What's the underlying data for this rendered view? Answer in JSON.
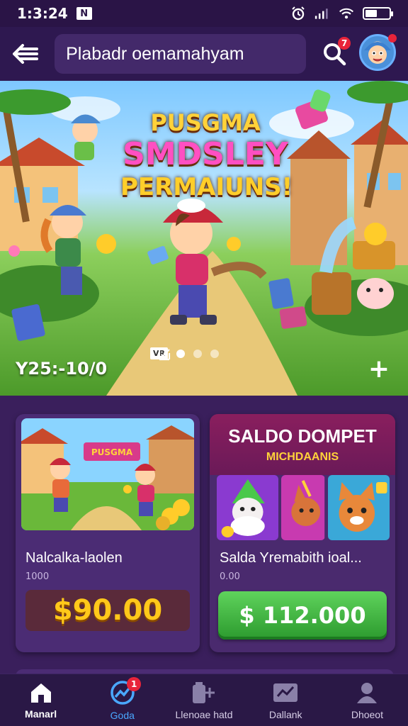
{
  "status_bar": {
    "time": "1:3:24",
    "notification_icon": "n-box-icon",
    "icons": [
      "alarm-icon",
      "signal-icon",
      "wifi-icon",
      "battery-icon"
    ]
  },
  "header": {
    "search_value": "Plabadr oemamahyam",
    "search_badge": "7",
    "icons": {
      "back": "back-arrow-icon",
      "search": "search-icon",
      "avatar": "avatar"
    }
  },
  "banner": {
    "title_line1": "PUSGMA",
    "title_line2": "SMDSLEY",
    "title_line3": "PERMAIUNS!",
    "amount": "Y25:-10/0",
    "tag": "VR",
    "dots": 3,
    "active_dot": 0,
    "plus_label": "+"
  },
  "cards": [
    {
      "name": "Nalcalka-laolen",
      "sub": "1000",
      "price": "$90.00",
      "thumb_caption": "PUSGMA"
    },
    {
      "head_title": "SALDO DOMPET",
      "head_sub": "MICHDAANIS",
      "name": "Salda Yremabith ioal...",
      "sub": "0.00",
      "price": "$ 112.000"
    }
  ],
  "bottom_nav": [
    {
      "label": "Manarl",
      "icon": "home-icon",
      "active": true
    },
    {
      "label": "Goda",
      "icon": "chart-icon",
      "badge": "1",
      "selected": true
    },
    {
      "label": "Llenoae hatd",
      "icon": "wallet-plus-icon"
    },
    {
      "label": "Dallank",
      "icon": "graph-card-icon"
    },
    {
      "label": "Dhoeot",
      "icon": "profile-icon"
    }
  ],
  "colors": {
    "background": "#3a1f5c",
    "accent_green": "#2c9a2e",
    "badge_red": "#e8243a",
    "gold": "#ffc81a",
    "nav_selected": "#4aa8ff"
  }
}
